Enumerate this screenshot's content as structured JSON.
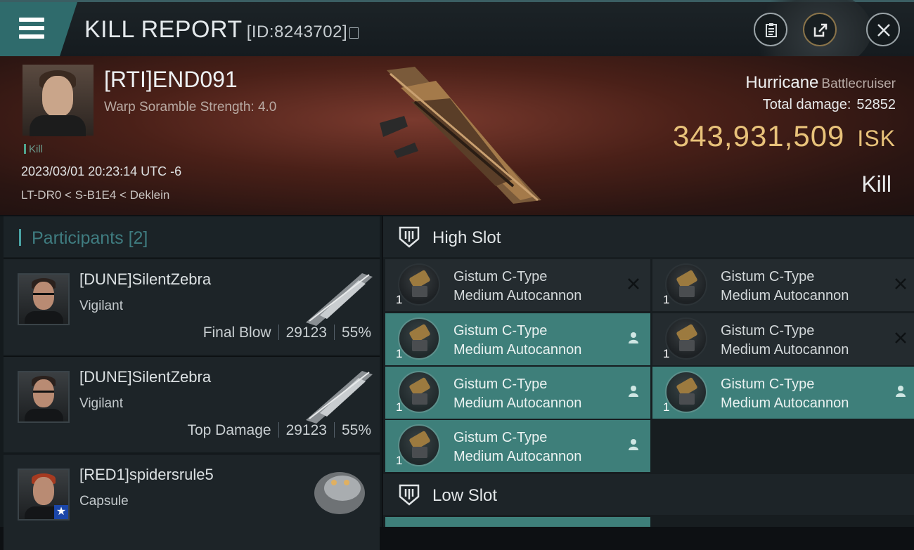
{
  "header": {
    "title": "KILL REPORT",
    "report_id": "[ID:8243702]"
  },
  "victim": {
    "name": "[RTI]END091",
    "warp_scramble": "Warp Soramble Strength: 4.0",
    "kill_tag": "Kill",
    "datetime": "2023/03/01 20:23:14 UTC -6",
    "location": "LT-DR0 < S-B1E4 < Deklein",
    "ship_name": "Hurricane",
    "ship_class": "Battlecruiser",
    "total_damage_label": "Total damage:",
    "total_damage": "52852",
    "isk_value": "343,931,509",
    "isk_unit": "ISK",
    "result": "Kill"
  },
  "participants": {
    "title": "Participants",
    "count": "[2]",
    "items": [
      {
        "name": "[DUNE]SilentZebra",
        "ship": "Vigilant",
        "role": "Final Blow",
        "damage": "29123",
        "percent": "55%"
      },
      {
        "name": "[DUNE]SilentZebra",
        "ship": "Vigilant",
        "role": "Top Damage",
        "damage": "29123",
        "percent": "55%"
      },
      {
        "name": "[RED1]spidersrule5",
        "ship": "Capsule"
      }
    ]
  },
  "slots": {
    "high_title": "High Slot",
    "low_title": "Low Slot",
    "modules": [
      {
        "line1": "Gistum C-Type",
        "line2": "Medium Autocannon",
        "qty": "1",
        "state": "destroyed"
      },
      {
        "line1": "Gistum C-Type",
        "line2": "Medium Autocannon",
        "qty": "1",
        "state": "destroyed"
      },
      {
        "line1": "Gistum C-Type",
        "line2": "Medium Autocannon",
        "qty": "1",
        "state": "dropped"
      },
      {
        "line1": "Gistum C-Type",
        "line2": "Medium Autocannon",
        "qty": "1",
        "state": "destroyed"
      },
      {
        "line1": "Gistum C-Type",
        "line2": "Medium Autocannon",
        "qty": "1",
        "state": "dropped"
      },
      {
        "line1": "Gistum C-Type",
        "line2": "Medium Autocannon",
        "qty": "1",
        "state": "dropped"
      },
      {
        "line1": "Gistum C-Type",
        "line2": "Medium Autocannon",
        "qty": "1",
        "state": "dropped"
      }
    ]
  },
  "colors": {
    "accent": "#3e7f7a",
    "isk": "#e8c27a",
    "header_teal": "#2f6b6c"
  }
}
